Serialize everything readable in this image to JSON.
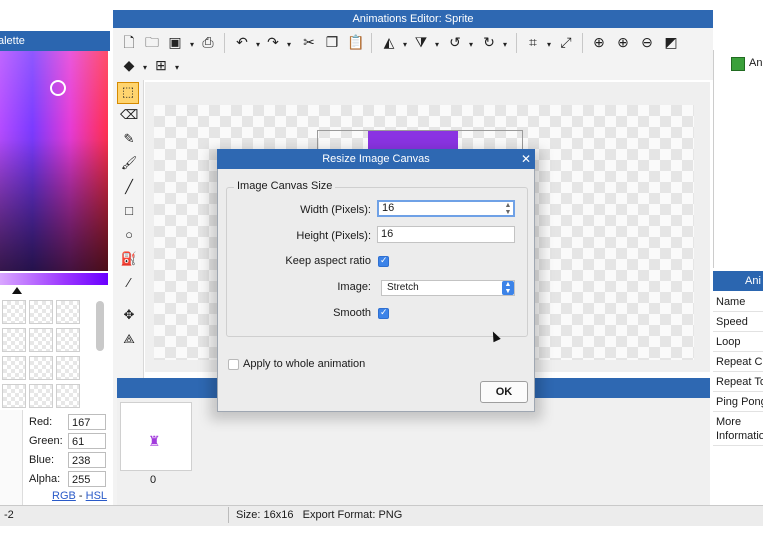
{
  "window": {
    "title": "Animations Editor: Sprite"
  },
  "palette": {
    "header": "alette",
    "rgba": {
      "red_label": "Red:",
      "red": "167",
      "green_label": "Green:",
      "green": "61",
      "blue_label": "Blue:",
      "blue": "238",
      "alpha_label": "Alpha:",
      "alpha": "255"
    },
    "link_rgb": "RGB",
    "link_sep": "-",
    "link_hsl": "HSL",
    "colors": {
      "selected": "#a73dee",
      "accent": "#2e68b2"
    }
  },
  "toolbar": {
    "icons": [
      "new-file-icon",
      "open-folder-icon",
      "save-icon",
      "save-dropdown-icon",
      "export-icon",
      "undo-icon",
      "undo-dropdown-icon",
      "redo-icon",
      "redo-dropdown-icon",
      "cut-icon",
      "copy-icon",
      "paste-icon",
      "flip-horizontal-icon",
      "flip-dropdown-icon",
      "flip-vertical-icon",
      "flip-vertical-dropdown-icon",
      "rotate-ccw-icon",
      "rotate-ccw-dropdown-icon",
      "rotate-cw-icon",
      "rotate-cw-dropdown-icon",
      "crop-icon",
      "crop-dropdown-icon",
      "resize-icon",
      "zoom-fit-icon",
      "zoom-in-icon",
      "zoom-out-icon",
      "color-picker-icon",
      "layers-icon",
      "layers-dropdown-icon",
      "grid-icon",
      "grid-dropdown-icon"
    ]
  },
  "tools": [
    "select-rect-icon",
    "eraser-icon",
    "pencil-icon",
    "brush-icon",
    "line-icon",
    "rectangle-icon",
    "ellipse-icon",
    "fill-bucket-icon",
    "eyedropper-icon",
    "move-icon",
    "path-icon"
  ],
  "timeline": {
    "frame_index": "0"
  },
  "right_panel": {
    "item_label": "An",
    "anim_header": "Ani",
    "properties": [
      "Name",
      "Speed",
      "Loop",
      "Repeat Co",
      "Repeat To",
      "Ping Pong",
      "More",
      "Informatio"
    ]
  },
  "status": {
    "left": "-2",
    "size": "Size: 16x16",
    "export_format": "Export Format: PNG"
  },
  "dialog": {
    "title": "Resize Image Canvas",
    "close": "✕",
    "group_label": "Image Canvas Size",
    "width_label": "Width (Pixels):",
    "width_value": "16",
    "height_label": "Height (Pixels):",
    "height_value": "16",
    "keep_aspect_label": "Keep aspect ratio",
    "keep_aspect_checked": true,
    "image_label": "Image:",
    "image_value": "Stretch",
    "smooth_label": "Smooth",
    "smooth_checked": true,
    "apply_label": "Apply to whole animation",
    "apply_checked": false,
    "ok_label": "OK"
  }
}
